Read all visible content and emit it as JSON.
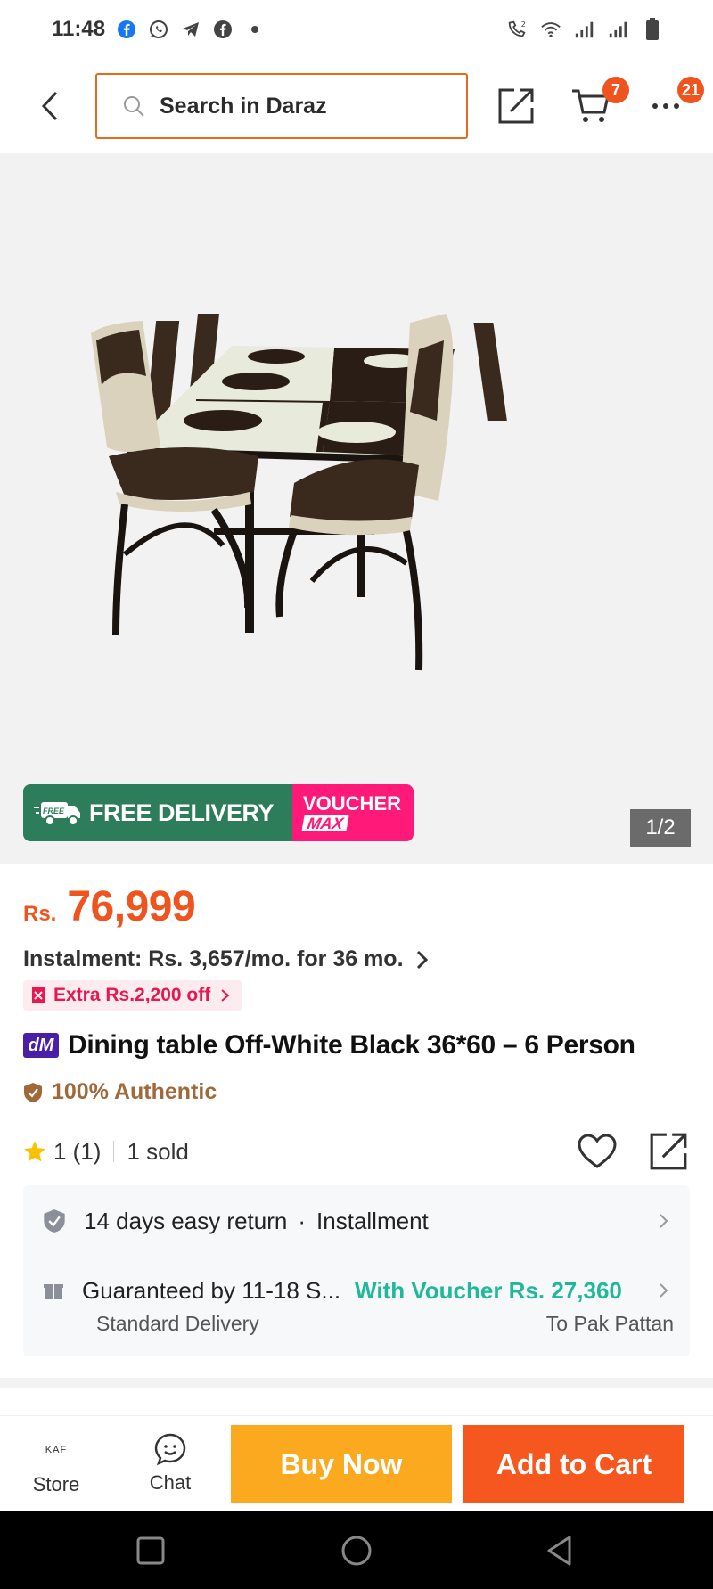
{
  "status_bar": {
    "time": "11:48",
    "icons": [
      "facebook-icon",
      "whatsapp-icon",
      "telegram-icon",
      "facebook-messenger-icon",
      "dot-icon",
      "wifi-call-icon",
      "wifi-icon",
      "signal-icon",
      "signal-icon",
      "battery-icon"
    ]
  },
  "header": {
    "search_placeholder": "Search in Daraz",
    "cart_count": "7",
    "more_count": "21"
  },
  "gallery": {
    "free_delivery": "FREE DELIVERY",
    "free_tag": "FREE",
    "voucher_line1": "VOUCHER",
    "voucher_line2": "MAX",
    "pager": "1/2"
  },
  "product": {
    "currency": "Rs.",
    "price": "76,999",
    "instalment": "Instalment: Rs. 3,657/mo. for 36 mo.",
    "extra_off": "Extra Rs.2,200 off",
    "brand_tag": "dM",
    "title": "Dining table Off-White Black 36*60 – 6 Person",
    "authentic": "100% Authentic",
    "rating": "1 (1)",
    "sold": "1 sold"
  },
  "info": {
    "return": "14 days easy return",
    "installment": "Installment",
    "guarantee": "Guaranteed by 11-18 S...",
    "voucher": "With Voucher Rs. 27,360",
    "delivery_type": "Standard Delivery",
    "destination": "To Pak Pattan"
  },
  "actions": {
    "store_logo": "KAF",
    "store_label": "Store",
    "chat_label": "Chat",
    "buy_now": "Buy Now",
    "add_to_cart": "Add to Cart"
  },
  "colors": {
    "accent": "#f5571e",
    "buy_now": "#fba91e",
    "free_delivery": "#2e7d5a",
    "voucher": "#ff1a79",
    "voucher_text": "#1fb99a",
    "authentic": "#a0693a"
  }
}
